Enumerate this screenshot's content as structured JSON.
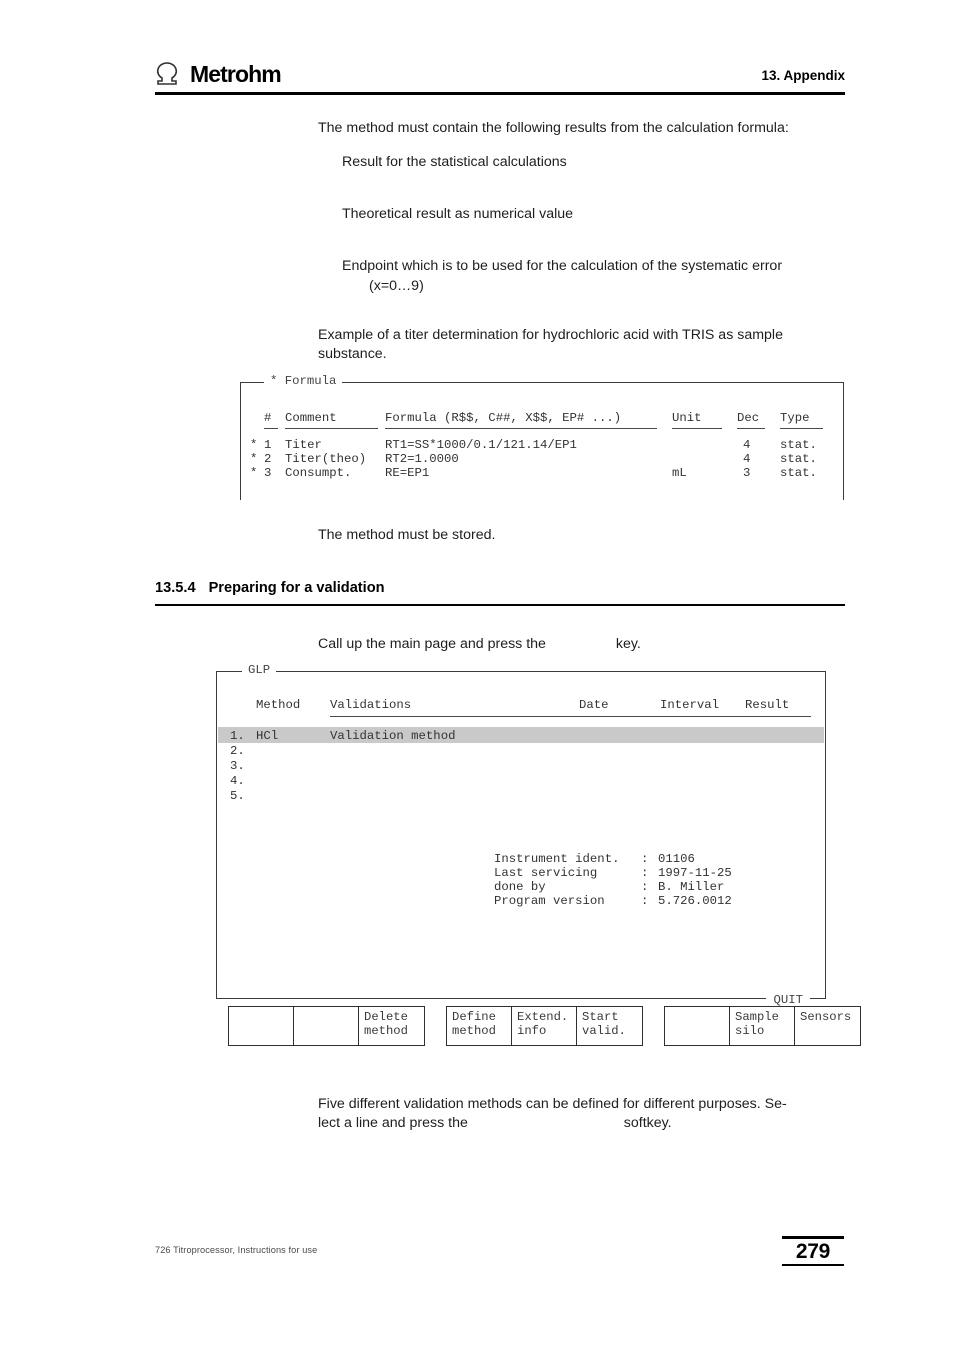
{
  "header": {
    "brand": "Metrohm",
    "logo_icon": "omega-arch-icon",
    "chapter": "13. Appendix"
  },
  "body": {
    "intro": "The method must contain the following results from the calculation formula:",
    "bullets": [
      "Result for the statistical calculations",
      "Theoretical result as numerical value",
      "Endpoint which is to be used for the calculation of the systematic error",
      "(x=0…9)"
    ],
    "example_line1": "Example of a titer determination for hydrochloric acid with TRIS as sample",
    "example_line2": "substance.",
    "stored_note": "The method must be stored.",
    "call_up_prefix": "Call up the main page and press the",
    "call_up_suffix": "key.",
    "closing_line1": "Five different validation methods can be defined for different purposes. Se-",
    "closing_line2_prefix": "lect a line and press the",
    "closing_line2_suffix": "softkey."
  },
  "heading": {
    "number": "13.5.4",
    "title": "Preparing for a validation"
  },
  "formula_screen": {
    "legend": "* Formula",
    "columns": {
      "num": "#",
      "comment": "Comment",
      "formula": "Formula (R$$, C##, X$$, EP# ...)",
      "unit": "Unit",
      "dec": "Dec",
      "type": "Type"
    },
    "rows": [
      {
        "mark": "*",
        "num": "1",
        "comment": "Titer",
        "formula": "RT1=SS*1000/0.1/121.14/EP1",
        "unit": "",
        "dec": "4",
        "type": "stat."
      },
      {
        "mark": "*",
        "num": "2",
        "comment": "Titer(theo)",
        "formula": "RT2=1.0000",
        "unit": "",
        "dec": "4",
        "type": "stat."
      },
      {
        "mark": "*",
        "num": "3",
        "comment": "Consumpt.",
        "formula": "RE=EP1",
        "unit": "mL",
        "dec": "3",
        "type": "stat."
      }
    ]
  },
  "glp_screen": {
    "legend": "GLP",
    "quit_label": "QUIT",
    "columns": {
      "method": "Method",
      "validations": "Validations",
      "date": "Date",
      "interval": "Interval",
      "result": "Result"
    },
    "rows": [
      {
        "index": "1.",
        "method": "HCl",
        "validations": "Validation method",
        "date": "",
        "interval": "",
        "result": "",
        "selected": true
      },
      {
        "index": "2.",
        "method": "",
        "validations": "",
        "date": "",
        "interval": "",
        "result": "",
        "selected": false
      },
      {
        "index": "3.",
        "method": "",
        "validations": "",
        "date": "",
        "interval": "",
        "result": "",
        "selected": false
      },
      {
        "index": "4.",
        "method": "",
        "validations": "",
        "date": "",
        "interval": "",
        "result": "",
        "selected": false
      },
      {
        "index": "5.",
        "method": "",
        "validations": "",
        "date": "",
        "interval": "",
        "result": "",
        "selected": false
      }
    ],
    "info": [
      {
        "label": "Instrument ident.",
        "sep": ":",
        "value": "01106"
      },
      {
        "label": "Last servicing",
        "sep": ":",
        "value": "1997-11-25"
      },
      {
        "label": "done by",
        "sep": ":",
        "value": "B. Miller"
      },
      {
        "label": "Program version",
        "sep": ":",
        "value": "5.726.0012"
      }
    ],
    "highlight_color": "#c9c9c9"
  },
  "softkeys": {
    "groups": [
      {
        "cells": [
          {
            "label": ""
          },
          {
            "label": ""
          },
          {
            "label": "Delete\nmethod"
          }
        ]
      },
      {
        "cells": [
          {
            "label": "Define\nmethod"
          },
          {
            "label": "Extend.\ninfo"
          },
          {
            "label": "Start\nvalid."
          }
        ]
      },
      {
        "cells": [
          {
            "label": ""
          },
          {
            "label": "Sample\nsilo"
          },
          {
            "label": "Sensors"
          }
        ]
      }
    ]
  },
  "footer": {
    "doc_title": "726 Titroprocessor, Instructions for use",
    "page_number": "279"
  }
}
